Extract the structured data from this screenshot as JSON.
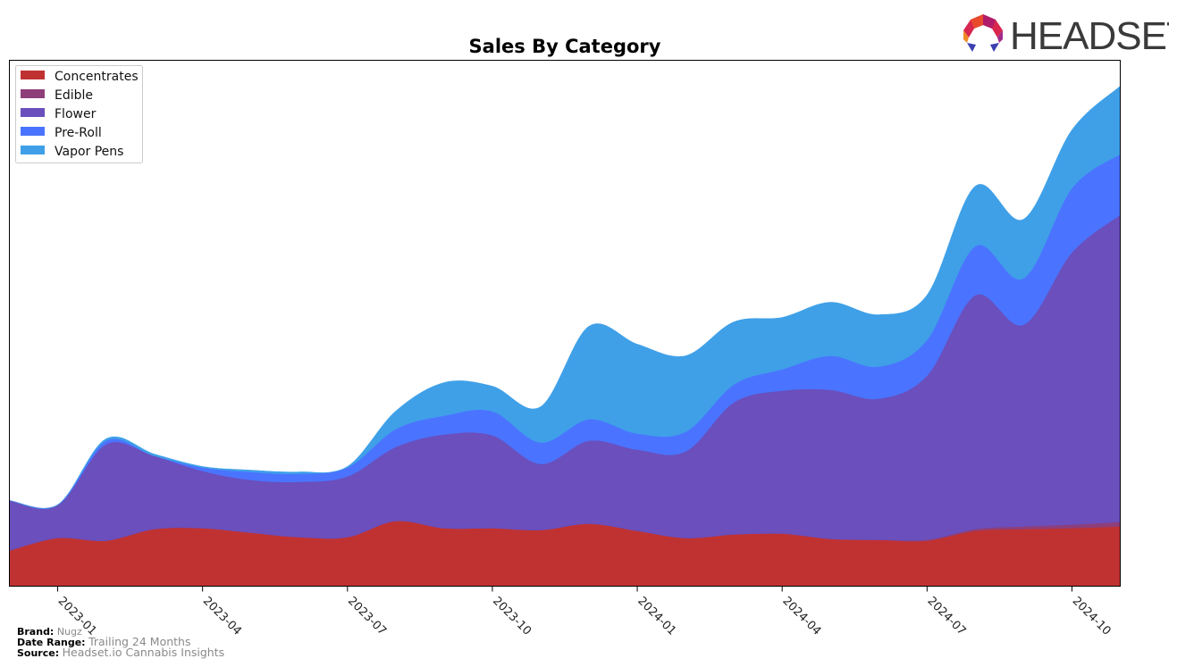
{
  "logo": {
    "text": "HEADSET",
    "icon": "headset-logo-icon"
  },
  "footer": {
    "brand_label": "Brand:",
    "brand_value": "Nugz",
    "date_range_label": "Date Range:",
    "date_range_value": "Trailing 24 Months",
    "source_label": "Source:",
    "source_value": "Headset.io Cannabis Insights"
  },
  "chart_data": {
    "type": "area",
    "stacked": true,
    "title": "Sales By Category",
    "xlabel": "",
    "ylabel": "",
    "y_ticks_visible": false,
    "grid": false,
    "legend_position": "top-left",
    "x": [
      "2022-12",
      "2023-01",
      "2023-02",
      "2023-03",
      "2023-04",
      "2023-05",
      "2023-06",
      "2023-07",
      "2023-08",
      "2023-09",
      "2023-10",
      "2023-11",
      "2023-12",
      "2024-01",
      "2024-02",
      "2024-03",
      "2024-04",
      "2024-05",
      "2024-06",
      "2024-07",
      "2024-08",
      "2024-09",
      "2024-10",
      "2024-11"
    ],
    "x_tick_labels": [
      "2023-01",
      "2023-04",
      "2023-07",
      "2023-10",
      "2024-01",
      "2024-04",
      "2024-07",
      "2024-10"
    ],
    "ylim": [
      0,
      589
    ],
    "units": "relative (unlabeled axis)",
    "series": [
      {
        "name": "Concentrates",
        "color": "#c03232",
        "values": [
          40,
          54,
          51,
          64,
          65,
          60,
          55,
          55,
          73,
          65,
          65,
          63,
          70,
          62,
          54,
          58,
          59,
          53,
          52,
          51,
          62,
          64,
          65,
          67
        ]
      },
      {
        "name": "Edible",
        "color": "#8e3f7a",
        "values": [
          0,
          0,
          0,
          0,
          0,
          0,
          0,
          0,
          0,
          0,
          0,
          0,
          0,
          0,
          0,
          0,
          0,
          0,
          0,
          1,
          2,
          3,
          4,
          5
        ]
      },
      {
        "name": "Flower",
        "color": "#6a4fbd",
        "values": [
          56,
          37,
          108,
          82,
          64,
          59,
          62,
          68,
          83,
          105,
          104,
          74,
          93,
          91,
          97,
          148,
          160,
          167,
          158,
          184,
          262,
          226,
          305,
          344
        ]
      },
      {
        "name": "Pre-Roll",
        "color": "#4a74ff",
        "values": [
          0,
          0,
          4,
          0,
          4,
          9,
          9,
          10,
          20,
          21,
          27,
          24,
          24,
          18,
          22,
          20,
          24,
          38,
          36,
          40,
          55,
          52,
          72,
          68
        ]
      },
      {
        "name": "Vapor Pens",
        "color": "#3fa0e8",
        "values": [
          0,
          0,
          2,
          2,
          1,
          2,
          2,
          1,
          20,
          37,
          28,
          40,
          104,
          100,
          85,
          70,
          58,
          60,
          58,
          50,
          67,
          66,
          65,
          76
        ]
      }
    ]
  }
}
